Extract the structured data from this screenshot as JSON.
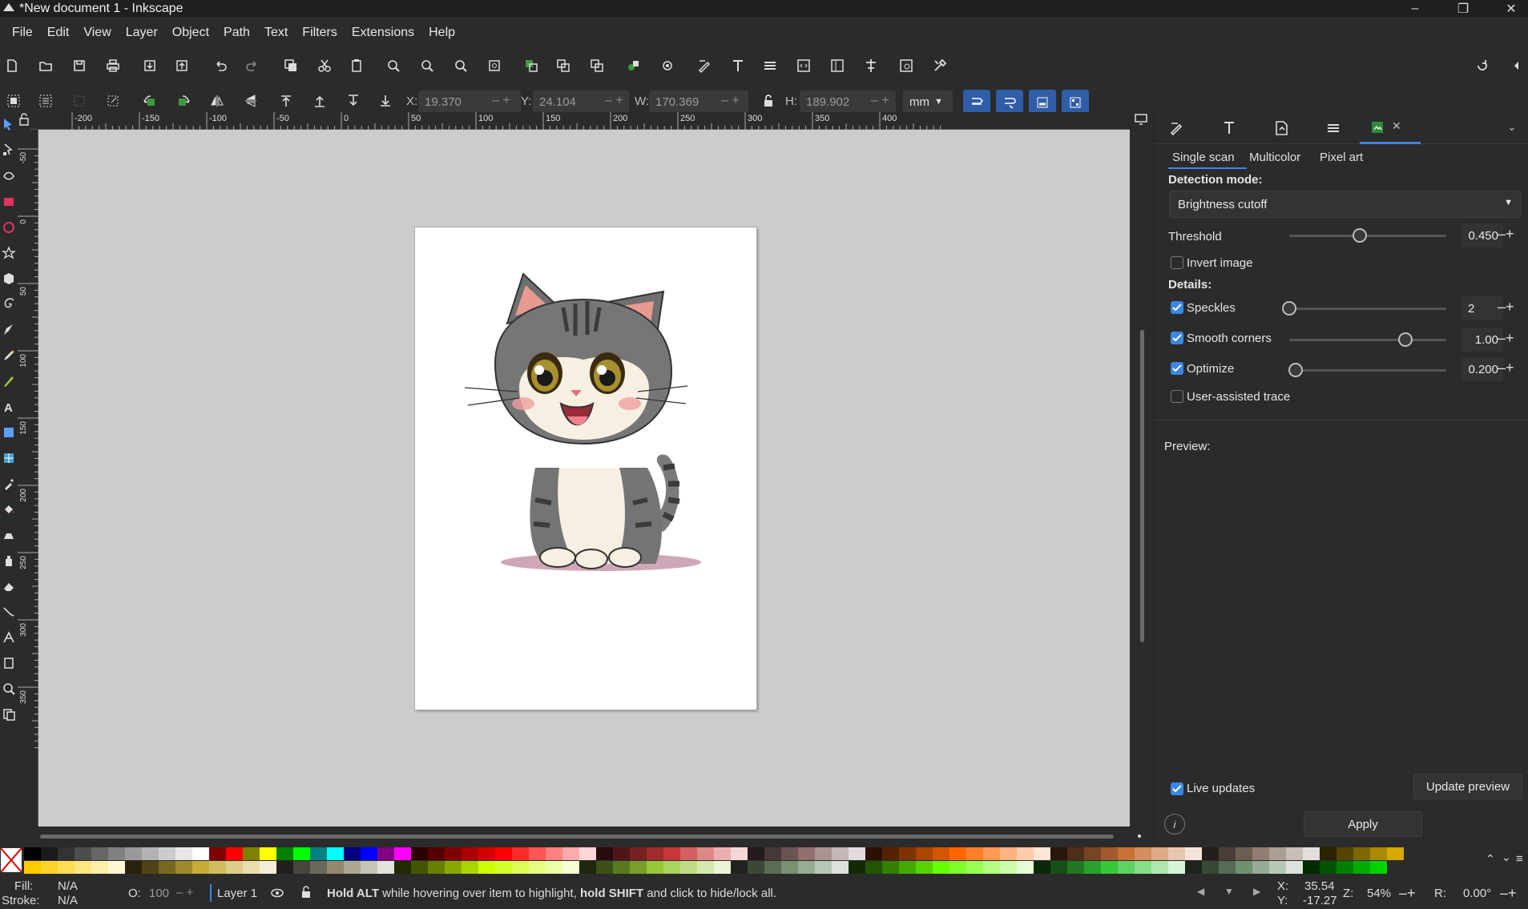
{
  "window": {
    "title": "*New document 1 - Inkscape",
    "controls": [
      "minimize-icon",
      "restore-icon",
      "close-icon"
    ]
  },
  "menu": [
    "File",
    "Edit",
    "View",
    "Layer",
    "Object",
    "Path",
    "Text",
    "Filters",
    "Extensions",
    "Help"
  ],
  "controls": {
    "x": {
      "label": "X:",
      "value": "19.370"
    },
    "y": {
      "label": "Y:",
      "value": "24.104"
    },
    "w": {
      "label": "W:",
      "value": "170.369"
    },
    "h": {
      "label": "H:",
      "value": "189.902"
    },
    "unit": "mm"
  },
  "ruler": {
    "h_ticks": [
      "-200",
      "-150",
      "-100",
      "-50",
      "0",
      "50",
      "100",
      "150",
      "200",
      "250",
      "300",
      "350",
      "400"
    ],
    "v_ticks": [
      "-50",
      "0",
      "50",
      "100",
      "150",
      "200",
      "250",
      "300",
      "350"
    ]
  },
  "trace": {
    "tabs": [
      "Single scan",
      "Multicolor",
      "Pixel art"
    ],
    "active_tab": "Single scan",
    "detection_label": "Detection mode:",
    "detection_value": "Brightness cutoff",
    "threshold_label": "Threshold",
    "threshold_value": "0.450",
    "threshold_level": 0.45,
    "invert_label": "Invert image",
    "invert_checked": false,
    "details_label": "Details:",
    "speckles_label": "Speckles",
    "speckles_value": "2",
    "speckles_checked": true,
    "speckles_level": 0.0,
    "smooth_label": "Smooth corners",
    "smooth_value": "1.00",
    "smooth_checked": true,
    "smooth_level": 0.74,
    "optimize_label": "Optimize",
    "optimize_value": "0.200",
    "optimize_checked": true,
    "optimize_level": 0.04,
    "user_assisted_label": "User-assisted trace",
    "user_assisted_checked": false,
    "preview_label": "Preview:",
    "live_updates_label": "Live updates",
    "live_updates_checked": true,
    "update_preview_label": "Update preview",
    "apply_label": "Apply"
  },
  "palette": {
    "row1": [
      "#000000",
      "#1a1a1a",
      "#333333",
      "#4d4d4d",
      "#666666",
      "#808080",
      "#999999",
      "#b3b3b3",
      "#cccccc",
      "#e6e6e6",
      "#ffffff",
      "#800000",
      "#ff0000",
      "#808000",
      "#ffff00",
      "#008000",
      "#00ff00",
      "#008080",
      "#00ffff",
      "#000080",
      "#0000ff",
      "#800080",
      "#ff00ff",
      "#2b0000",
      "#550000",
      "#800000",
      "#aa0000",
      "#d40000",
      "#ff0000",
      "#ff2a2a",
      "#ff5555",
      "#ff8080",
      "#ffaaaa",
      "#ffd5d5",
      "#280b0b",
      "#501616",
      "#782121",
      "#a02c2c",
      "#c83737",
      "#d35f5f",
      "#de8787",
      "#e9afaf",
      "#f4d7d7",
      "#241c1c",
      "#483737",
      "#6c5353",
      "#916f6f",
      "#ac9393",
      "#c8b7b7",
      "#e3dbdb",
      "#2b1100",
      "#552200",
      "#803300",
      "#aa4400",
      "#d45500",
      "#ff6600",
      "#ff7f2a",
      "#ff9955",
      "#ffb380",
      "#ffccaa",
      "#ffe6d5",
      "#28170b",
      "#502d16",
      "#784421",
      "#a05a2c",
      "#c87137",
      "#d38d5f",
      "#deaa87",
      "#e9c6af",
      "#f4e3d7",
      "#241f1c",
      "#483e37",
      "#6c5d53",
      "#917c6f",
      "#ac9d93",
      "#c8beb7",
      "#e3dedb",
      "#2b2200",
      "#554400",
      "#806600",
      "#aa8800",
      "#d4aa00"
    ],
    "row2": [
      "#ffcc00",
      "#ffd42a",
      "#ffdd55",
      "#ffe680",
      "#ffeeaa",
      "#fff6d5",
      "#28220b",
      "#504416",
      "#786721",
      "#a0892c",
      "#c8ab37",
      "#d3bc5f",
      "#decd87",
      "#e9ddaf",
      "#f4eed7",
      "#241f1c",
      "#48443e",
      "#6c675d",
      "#918a6f",
      "#aca793",
      "#c8c4b7",
      "#e3e2db",
      "#222b00",
      "#445500",
      "#668000",
      "#88aa00",
      "#aad400",
      "#ccff00",
      "#d4ff2a",
      "#ddff55",
      "#e5ff80",
      "#eeffaa",
      "#f6ffd5",
      "#1e280b",
      "#3c5016",
      "#5a7821",
      "#789f2c",
      "#96c837",
      "#abd35f",
      "#c0de87",
      "#d5e9af",
      "#eaf4d7",
      "#1e241c",
      "#3c4837",
      "#5a6c53",
      "#78916f",
      "#96ac93",
      "#b5c8b7",
      "#dbe3db",
      "#112b00",
      "#225500",
      "#338000",
      "#44aa00",
      "#55d400",
      "#66ff00",
      "#7fff2a",
      "#99ff55",
      "#b3ff80",
      "#ccffaa",
      "#e5ffd5",
      "#0b280b",
      "#165016",
      "#217821",
      "#2ca02c",
      "#37c837",
      "#5fd35f",
      "#87de87",
      "#afe9af",
      "#d7f4d7",
      "#1c241c",
      "#374837",
      "#536c53",
      "#6f916f",
      "#93ac93",
      "#b7c8b7",
      "#dbe3db",
      "#002b00",
      "#005500",
      "#008000",
      "#00aa00",
      "#00d400"
    ]
  },
  "status": {
    "fill_label": "Fill:",
    "fill_value": "N/A",
    "stroke_label": "Stroke:",
    "stroke_value": "N/A",
    "opacity_label": "O:",
    "opacity_value": "100",
    "layer": "Layer 1",
    "message_b1": "Hold ALT",
    "message_t1": " while hovering over item to highlight, ",
    "message_b2": "hold SHIFT",
    "message_t2": " and click to hide/lock all.",
    "cursor_x_label": "X:",
    "cursor_x": "35.54",
    "cursor_y_label": "Y:",
    "cursor_y": "-17.27",
    "zoom_label": "Z:",
    "zoom": "54%",
    "rotate_label": "R:",
    "rotate": "0.00°"
  }
}
